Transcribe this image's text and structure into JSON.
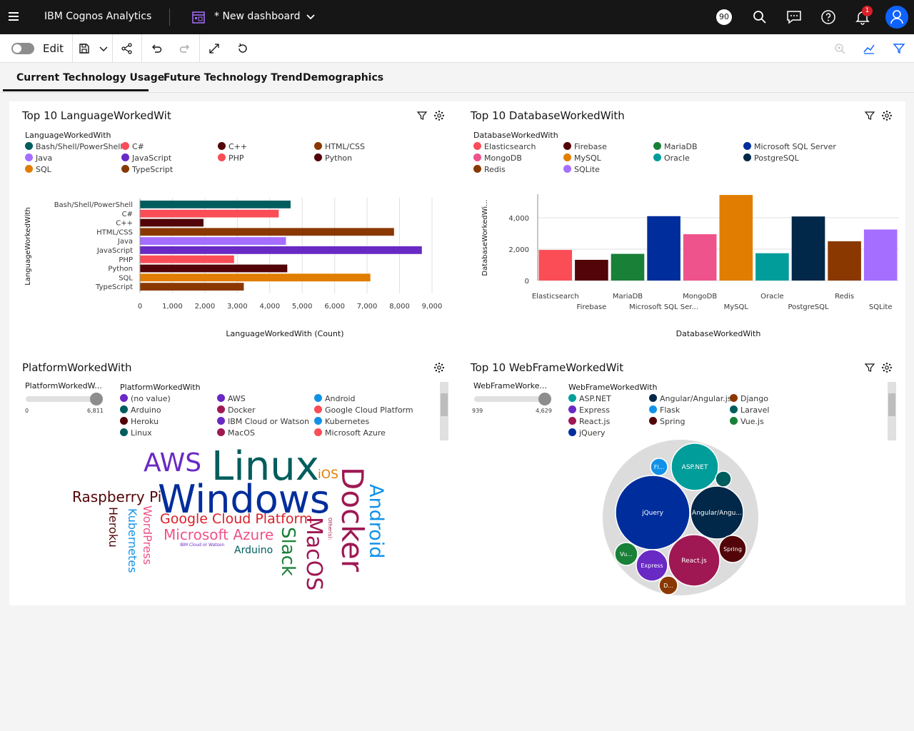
{
  "app": {
    "brand": "IBM Cognos Analytics",
    "dashboard_name": "* New dashboard",
    "badge_count": "90",
    "notification_count": "1"
  },
  "toolbar": {
    "edit_label": "Edit"
  },
  "tabs": [
    {
      "label": "Current Technology Usage",
      "active": true
    },
    {
      "label": "Future Technology Trend",
      "active": false
    },
    {
      "label": "Demographics",
      "active": false
    }
  ],
  "colors": {
    "teal_dark": "#005d5d",
    "red": "#fa4d56",
    "maroon": "#520408",
    "brown": "#8a3800",
    "purple_light": "#a56eff",
    "purple": "#6929c4",
    "orange": "#e17d00",
    "green": "#198038",
    "blue_dark": "#002d9c",
    "pink": "#ee538b",
    "teal": "#009d9a",
    "navy": "#012749",
    "cyan": "#1192e8",
    "magenta": "#9f1853"
  },
  "widgets": {
    "language": {
      "title": "Top 10 LanguageWorkedWit",
      "legend_title": "LanguageWorkedWith",
      "legend": [
        {
          "label": "Bash/Shell/PowerShell",
          "color": "#005d5d"
        },
        {
          "label": "C#",
          "color": "#fa4d56"
        },
        {
          "label": "C++",
          "color": "#520408"
        },
        {
          "label": "HTML/CSS",
          "color": "#8a3800"
        },
        {
          "label": "Java",
          "color": "#a56eff"
        },
        {
          "label": "JavaScript",
          "color": "#6929c4"
        },
        {
          "label": "PHP",
          "color": "#fa4d56"
        },
        {
          "label": "Python",
          "color": "#520408"
        },
        {
          "label": "SQL",
          "color": "#e17d00"
        },
        {
          "label": "TypeScript",
          "color": "#8a3800"
        }
      ],
      "ylabel": "LanguageWorkedWith",
      "xlabel": "LanguageWorkedWith (Count)"
    },
    "database": {
      "title": "Top 10 DatabaseWorkedWith",
      "legend_title": "DatabaseWorkedWith",
      "legend": [
        {
          "label": "Elasticsearch",
          "color": "#fa4d56"
        },
        {
          "label": "Firebase",
          "color": "#520408"
        },
        {
          "label": "MariaDB",
          "color": "#198038"
        },
        {
          "label": "Microsoft SQL Server",
          "color": "#002d9c"
        },
        {
          "label": "MongoDB",
          "color": "#ee538b"
        },
        {
          "label": "MySQL",
          "color": "#e17d00"
        },
        {
          "label": "Oracle",
          "color": "#009d9a"
        },
        {
          "label": "PostgreSQL",
          "color": "#012749"
        },
        {
          "label": "Redis",
          "color": "#8a3800"
        },
        {
          "label": "SQLite",
          "color": "#a56eff"
        }
      ],
      "ylabel": "DatabaseWorkedWi...",
      "xlabel": "DatabaseWorkedWith"
    },
    "platform": {
      "title": "PlatformWorkedWith",
      "slider_title": "PlatformWorkedW...",
      "slider_min": "0",
      "slider_max": "6,811",
      "legend_title": "PlatformWorkedWith",
      "legend": [
        {
          "label": "(no value)",
          "color": "#6929c4"
        },
        {
          "label": "AWS",
          "color": "#6929c4"
        },
        {
          "label": "Android",
          "color": "#1192e8"
        },
        {
          "label": "Arduino",
          "color": "#005d5d"
        },
        {
          "label": "Docker",
          "color": "#9f1853"
        },
        {
          "label": "Google Cloud Platform",
          "color": "#fa4d56"
        },
        {
          "label": "Heroku",
          "color": "#520408"
        },
        {
          "label": "IBM Cloud or Watson",
          "color": "#6929c4"
        },
        {
          "label": "Kubernetes",
          "color": "#1192e8"
        },
        {
          "label": "Linux",
          "color": "#005d5d"
        },
        {
          "label": "MacOS",
          "color": "#9f1853"
        },
        {
          "label": "Microsoft Azure",
          "color": "#fa4d56"
        }
      ],
      "cloud_words": [
        {
          "text": "AWS",
          "color": "#6929c4"
        },
        {
          "text": "Linux",
          "color": "#005d5d"
        },
        {
          "text": "iOS",
          "color": "#e17d00"
        },
        {
          "text": "Docker",
          "color": "#9f1853"
        },
        {
          "text": "Android",
          "color": "#1192e8"
        },
        {
          "text": "Raspberry Pi",
          "color": "#520408"
        },
        {
          "text": "Windows",
          "color": "#002d9c"
        },
        {
          "text": "Google Cloud Platform",
          "color": "#da1e28"
        },
        {
          "text": "Microsoft Azure",
          "color": "#ee538b"
        },
        {
          "text": "IBM Cloud or Watson",
          "color": "#6929c4"
        },
        {
          "text": "Arduino",
          "color": "#005d5d"
        },
        {
          "text": "Heroku",
          "color": "#520408"
        },
        {
          "text": "Kubernetes",
          "color": "#1192e8"
        },
        {
          "text": "WordPress",
          "color": "#ee538b"
        },
        {
          "text": "Slack",
          "color": "#198038"
        },
        {
          "text": "MacOS",
          "color": "#9f1853"
        },
        {
          "text": "Other(s):",
          "color": "#9f1853"
        }
      ]
    },
    "webframe": {
      "title": "Top 10 WebFrameWorkedWit",
      "slider_title": "WebFrameWorke...",
      "slider_min": "939",
      "slider_max": "4,629",
      "legend_title": "WebFrameWorkedWith",
      "legend": [
        {
          "label": "ASP.NET",
          "color": "#009d9a"
        },
        {
          "label": "Angular/Angular.js",
          "color": "#012749"
        },
        {
          "label": "Django",
          "color": "#8a3800"
        },
        {
          "label": "Express",
          "color": "#6929c4"
        },
        {
          "label": "Flask",
          "color": "#1192e8"
        },
        {
          "label": "Laravel",
          "color": "#005d5d"
        },
        {
          "label": "React.js",
          "color": "#9f1853"
        },
        {
          "label": "Spring",
          "color": "#520408"
        },
        {
          "label": "Vue.js",
          "color": "#198038"
        },
        {
          "label": "jQuery",
          "color": "#002d9c"
        }
      ]
    }
  },
  "chart_data": [
    {
      "type": "bar",
      "orientation": "horizontal",
      "title": "Top 10 LanguageWorkedWit",
      "categories": [
        "Bash/Shell/PowerShell",
        "C#",
        "C++",
        "HTML/CSS",
        "Java",
        "JavaScript",
        "PHP",
        "Python",
        "SQL",
        "TypeScript"
      ],
      "values": [
        4642,
        4277,
        1958,
        7830,
        4500,
        8687,
        2900,
        4540,
        7100,
        3200
      ],
      "colors": [
        "#005d5d",
        "#fa4d56",
        "#520408",
        "#8a3800",
        "#a56eff",
        "#6929c4",
        "#fa4d56",
        "#520408",
        "#e17d00",
        "#8a3800"
      ],
      "xlabel": "LanguageWorkedWith (Count)",
      "ylabel": "LanguageWorkedWith",
      "xlim": [
        0,
        9000
      ],
      "xticks": [
        "0",
        "1,000",
        "2,000",
        "3,000",
        "4,000",
        "5,000",
        "6,000",
        "7,000",
        "8,000",
        "9,000"
      ],
      "grid": true
    },
    {
      "type": "bar",
      "orientation": "vertical",
      "title": "Top 10 DatabaseWorkedWith",
      "categories": [
        "Elasticsearch",
        "Firebase",
        "MariaDB",
        "Microsoft SQL Ser...",
        "MongoDB",
        "MySQL",
        "Oracle",
        "PostgreSQL",
        "Redis",
        "SQLite"
      ],
      "values": [
        1950,
        1320,
        1700,
        4100,
        2950,
        5450,
        1740,
        4080,
        2500,
        3250
      ],
      "colors": [
        "#fa4d56",
        "#520408",
        "#198038",
        "#002d9c",
        "#ee538b",
        "#e17d00",
        "#009d9a",
        "#012749",
        "#8a3800",
        "#a56eff"
      ],
      "xlabel": "DatabaseWorkedWith",
      "ylabel": "DatabaseWorkedWi...",
      "ylim": [
        0,
        5500
      ],
      "yticks": [
        "0",
        "2,000",
        "4,000"
      ],
      "grid": true
    },
    {
      "type": "bubble",
      "title": "Top 10 WebFrameWorkedWit",
      "items": [
        {
          "label": "jQuery",
          "color": "#002d9c",
          "value": 4629
        },
        {
          "label": "Angular/Angu...",
          "color": "#012749",
          "value": 2400
        },
        {
          "label": "React.js",
          "color": "#9f1853",
          "value": 2750
        },
        {
          "label": "ASP.NET",
          "color": "#009d9a",
          "value": 2000
        },
        {
          "label": "Express",
          "color": "#6929c4",
          "value": 1000
        },
        {
          "label": "Spring",
          "color": "#520408",
          "value": 680
        },
        {
          "label": "Vu...",
          "color": "#198038",
          "value": 520
        },
        {
          "label": "Fl...",
          "color": "#1192e8",
          "value": 340
        },
        {
          "label": "D...",
          "color": "#8a3800",
          "value": 330
        },
        {
          "label": "",
          "color": "#005d5d",
          "value": 230
        }
      ]
    }
  ]
}
